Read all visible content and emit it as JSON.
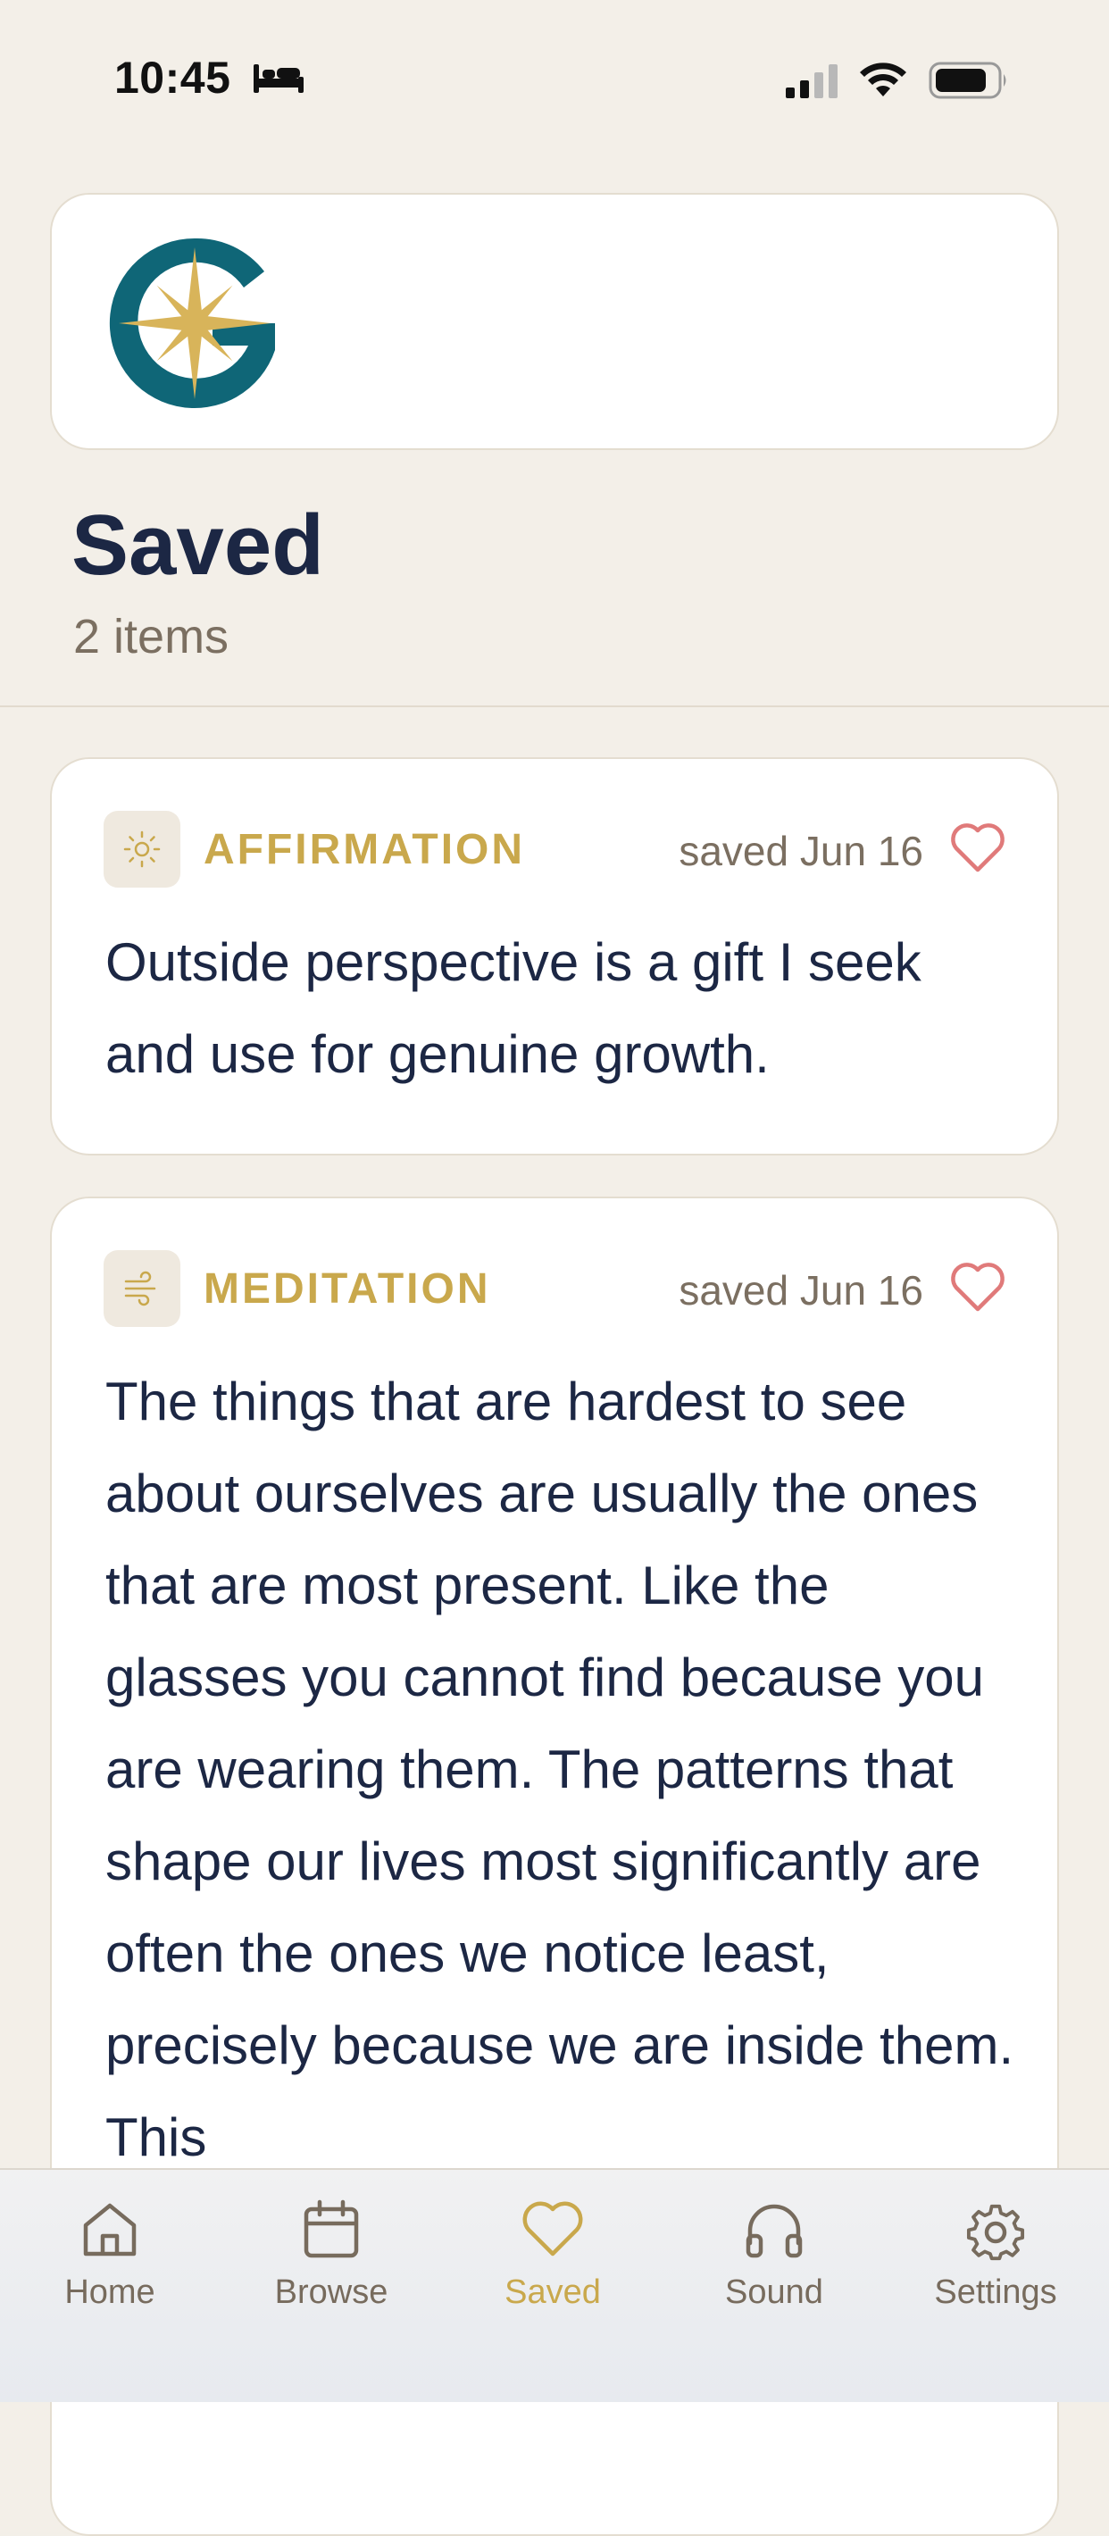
{
  "status_bar": {
    "time": "10:45"
  },
  "header": {
    "title": "Saved",
    "subtitle": "2 items"
  },
  "items": [
    {
      "category": "AFFIRMATION",
      "icon": "sun-icon",
      "saved": "saved Jun 16",
      "text": "Outside perspective is a gift I seek and use for genuine growth."
    },
    {
      "category": "MEDITATION",
      "icon": "wind-icon",
      "saved": "saved Jun 16",
      "text": "The things that are hardest to see about ourselves are usually the ones that are most present. Like the glasses you cannot find because you are wearing them. The patterns that shape our lives most significantly are often the ones we notice least, precisely because we are inside them. This"
    }
  ],
  "tab_bar": {
    "tabs": [
      {
        "label": "Home",
        "icon": "home-icon"
      },
      {
        "label": "Browse",
        "icon": "calendar-icon"
      },
      {
        "label": "Saved",
        "icon": "heart-icon",
        "active": true
      },
      {
        "label": "Sound",
        "icon": "headphones-icon"
      },
      {
        "label": "Settings",
        "icon": "gear-icon"
      }
    ]
  },
  "colors": {
    "background": "#f3efe8",
    "navy": "#1c2744",
    "gold": "#c9a84c",
    "teal": "#0f6677",
    "heart": "#e07a7a",
    "muted": "#7b6f61"
  }
}
